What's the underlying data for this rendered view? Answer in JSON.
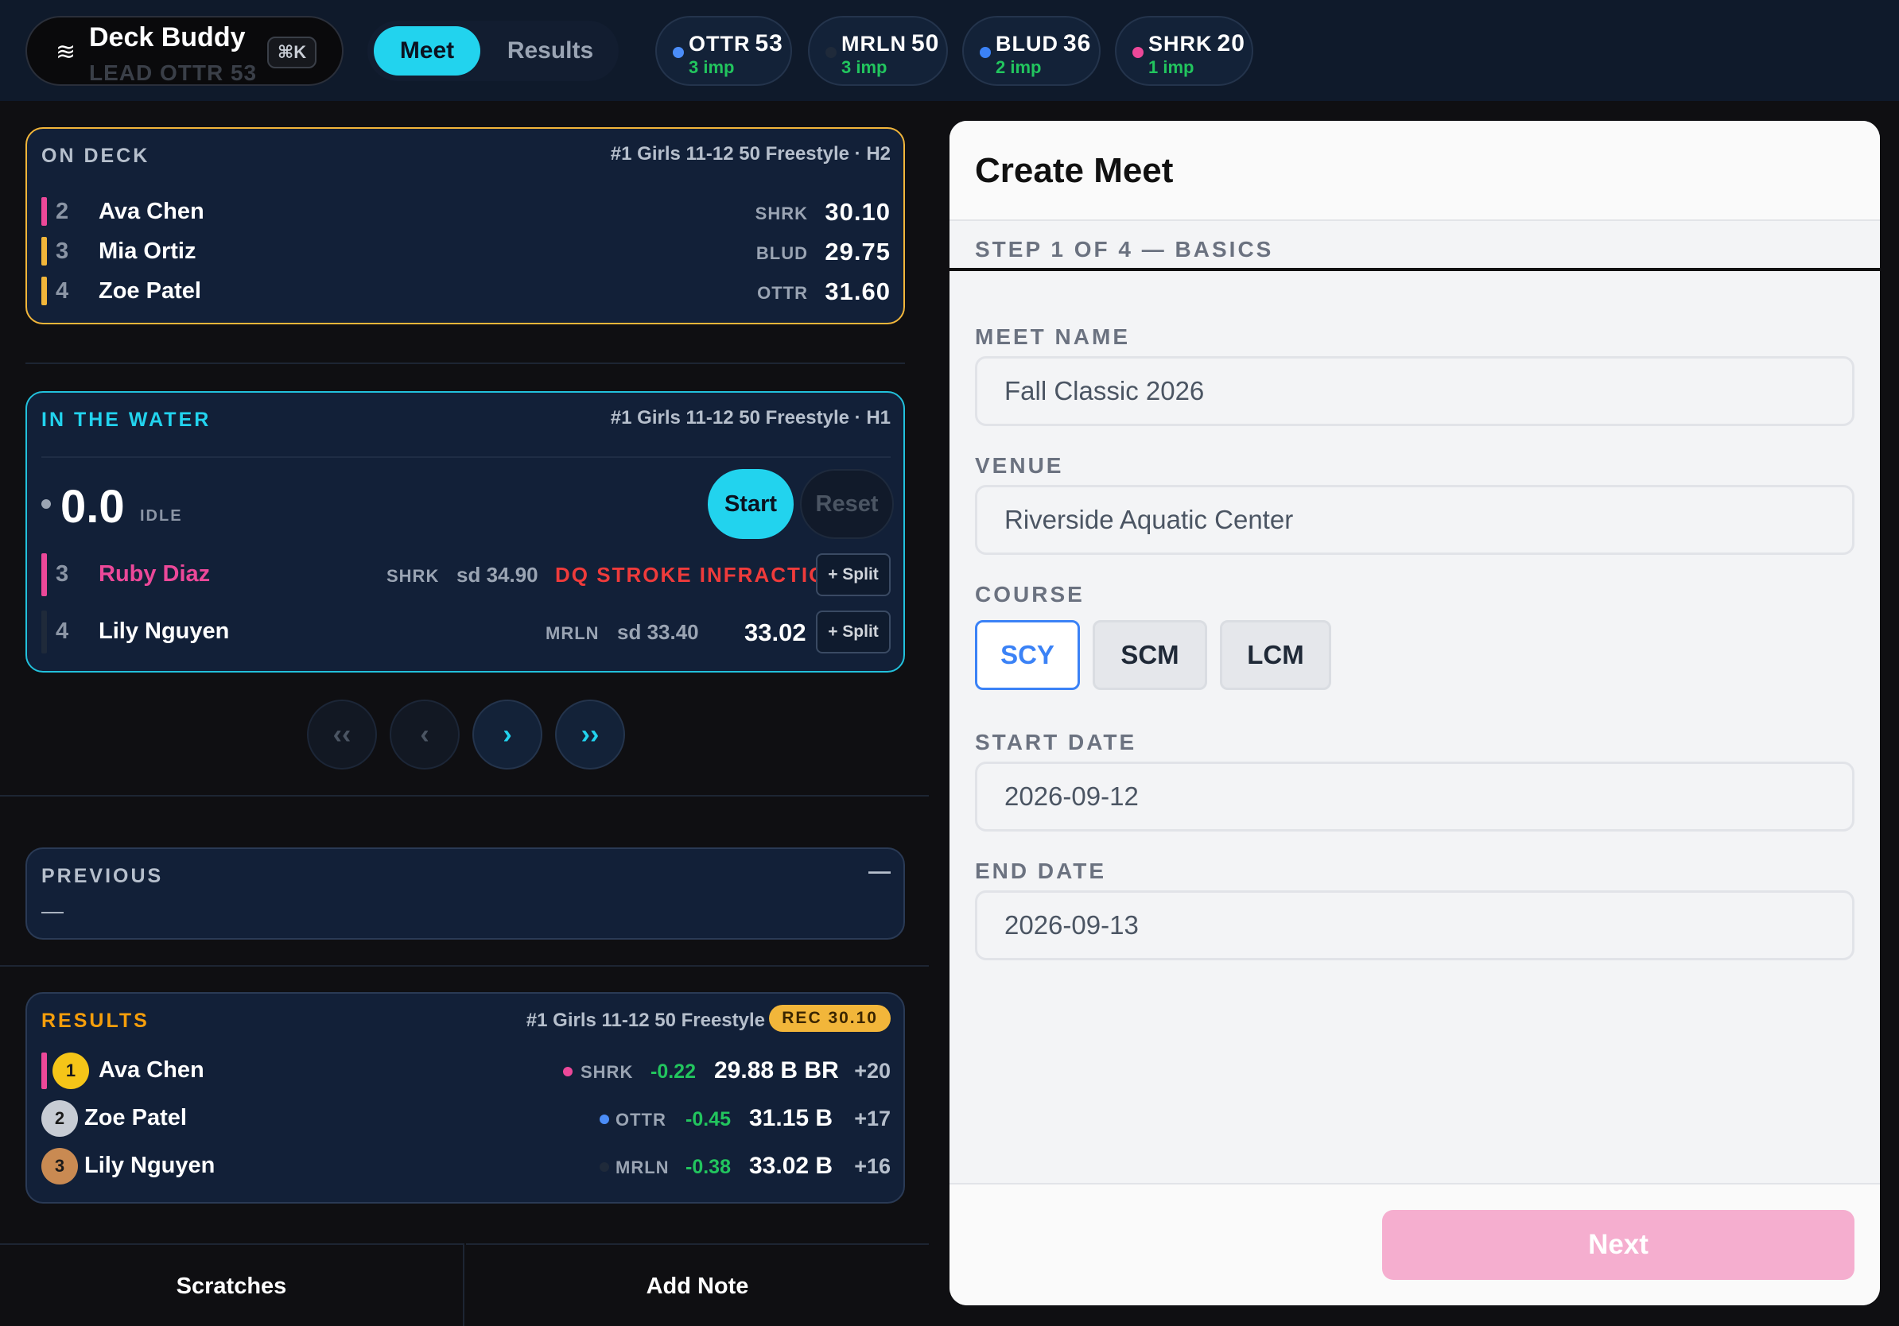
{
  "app": {
    "name": "Deck Buddy",
    "lead": "LEAD OTTR 53",
    "shortcut": "⌘K",
    "menu_icon": "waves-icon"
  },
  "tabs": {
    "meet": "Meet",
    "results": "Results"
  },
  "teams": [
    {
      "code": "OTTR",
      "points": "53",
      "imp": "3 imp",
      "color": "#4b8df8"
    },
    {
      "code": "MRLN",
      "points": "50",
      "imp": "3 imp",
      "color": "#1f2a3a"
    },
    {
      "code": "BLUD",
      "points": "36",
      "imp": "2 imp",
      "color": "#3b82f6"
    },
    {
      "code": "SHRK",
      "points": "20",
      "imp": "1 imp",
      "color": "#ec4899"
    }
  ],
  "on_deck": {
    "title": "ON DECK",
    "event": "#1 Girls 11-12 50 Freestyle · H2",
    "rows": [
      {
        "lane": "2",
        "name": "Ava Chen",
        "team": "SHRK",
        "time": "30.10",
        "color": "#ec4899"
      },
      {
        "lane": "3",
        "name": "Mia Ortiz",
        "team": "BLUD",
        "time": "29.75",
        "color": "#f2b63a"
      },
      {
        "lane": "4",
        "name": "Zoe Patel",
        "team": "OTTR",
        "time": "31.60",
        "color": "#f2b63a"
      }
    ]
  },
  "in_water": {
    "title": "IN THE WATER",
    "event": "#1 Girls 11-12 50 Freestyle · H1",
    "clock": "0.0",
    "state": "IDLE",
    "start": "Start",
    "reset": "Reset",
    "rows": [
      {
        "lane": "3",
        "name": "Ruby Diaz",
        "team": "SHRK",
        "seed": "sd 34.90",
        "status": "DQ STROKE INFRACTION",
        "split": "+ Split",
        "color": "#ec4899"
      },
      {
        "lane": "4",
        "name": "Lily Nguyen",
        "team": "MRLN",
        "seed": "sd 33.40",
        "status": "33.02",
        "split": "+ Split",
        "color": "#1f2a3a"
      }
    ]
  },
  "nav": {
    "first": "‹‹",
    "prev": "‹",
    "next": "›",
    "last": "››"
  },
  "previous": {
    "title": "PREVIOUS",
    "collapse": "—",
    "value": "—"
  },
  "results": {
    "title": "RESULTS",
    "event": "#1 Girls 11-12 50 Freestyle",
    "record": "REC 30.10",
    "rows": [
      {
        "place": "1",
        "name": "Ava Chen",
        "team": "SHRK",
        "delta": "-0.22",
        "time": "29.88 B BR",
        "points": "+20",
        "dot": "#ec4899",
        "medal": "#f5c518"
      },
      {
        "place": "2",
        "name": "Zoe Patel",
        "team": "OTTR",
        "delta": "-0.45",
        "time": "31.15 B",
        "points": "+17",
        "dot": "#4b8df8",
        "medal": "#c7ccd4"
      },
      {
        "place": "3",
        "name": "Lily Nguyen",
        "team": "MRLN",
        "delta": "-0.38",
        "time": "33.02 B",
        "points": "+16",
        "dot": "#1f2a3a",
        "medal": "#c98a52"
      }
    ]
  },
  "bottom": {
    "scratches": "Scratches",
    "add_note": "Add Note"
  },
  "create_meet": {
    "title": "Create Meet",
    "step": "STEP 1 OF 4 — BASICS",
    "meet_name_label": "MEET NAME",
    "meet_name": "Fall Classic 2026",
    "venue_label": "VENUE",
    "venue": "Riverside Aquatic Center",
    "course_label": "COURSE",
    "courses": [
      "SCY",
      "SCM",
      "LCM"
    ],
    "selected_course": "SCY",
    "start_date_label": "START DATE",
    "start_date": "2026-09-12",
    "end_date_label": "END DATE",
    "end_date": "2026-09-13",
    "next": "Next"
  }
}
